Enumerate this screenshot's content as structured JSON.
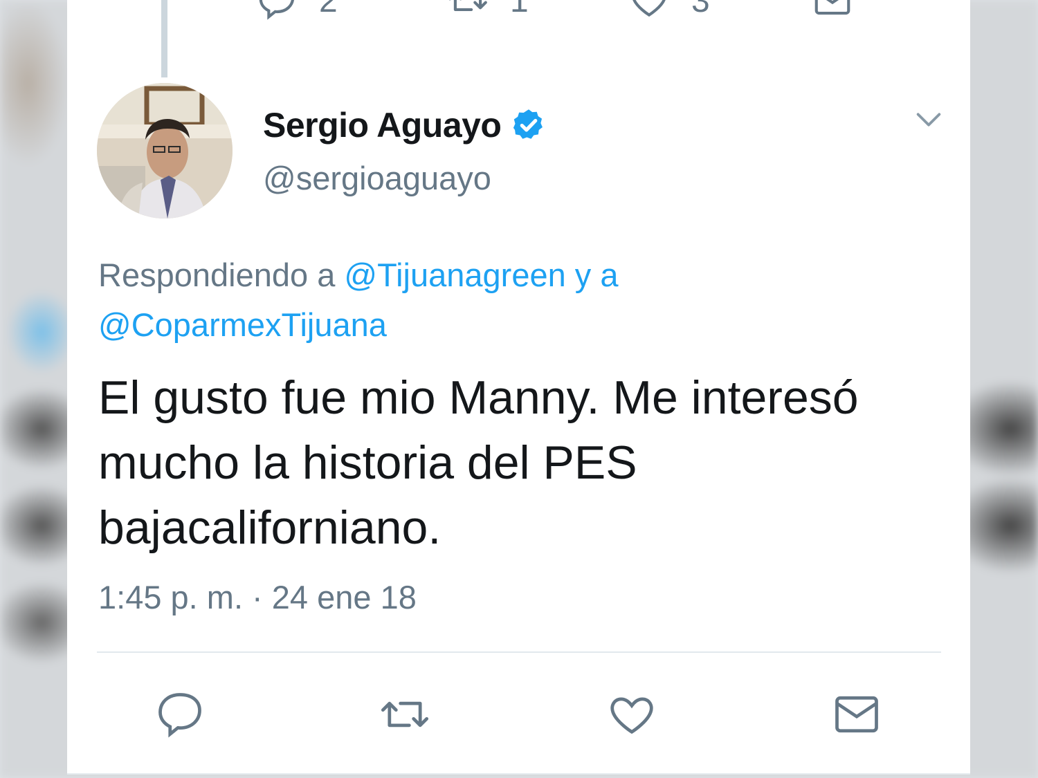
{
  "top_actions": {
    "reply_count": "2",
    "retweet_count": "1",
    "like_count": "3"
  },
  "author": {
    "name": "Sergio Aguayo",
    "handle": "@sergioaguayo",
    "verified": true
  },
  "reply_to": {
    "prefix": "Respondiendo a",
    "mention_1": "@Tijuanagreen",
    "connector": "y a",
    "mention_2": "@CoparmexTijuana"
  },
  "tweet": {
    "text": "El gusto fue mio Manny. Me interesó mucho la historia del PES bajacaliforniano.",
    "timestamp": "1:45 p. m. · 24 ene 18"
  },
  "actions": {
    "reply_icon": "reply-icon",
    "retweet_icon": "retweet-icon",
    "like_icon": "heart-icon",
    "share_icon": "envelope-icon"
  },
  "colors": {
    "link": "#1da1f2",
    "muted": "#657786",
    "text": "#14171a",
    "verified": "#1da1f2"
  }
}
